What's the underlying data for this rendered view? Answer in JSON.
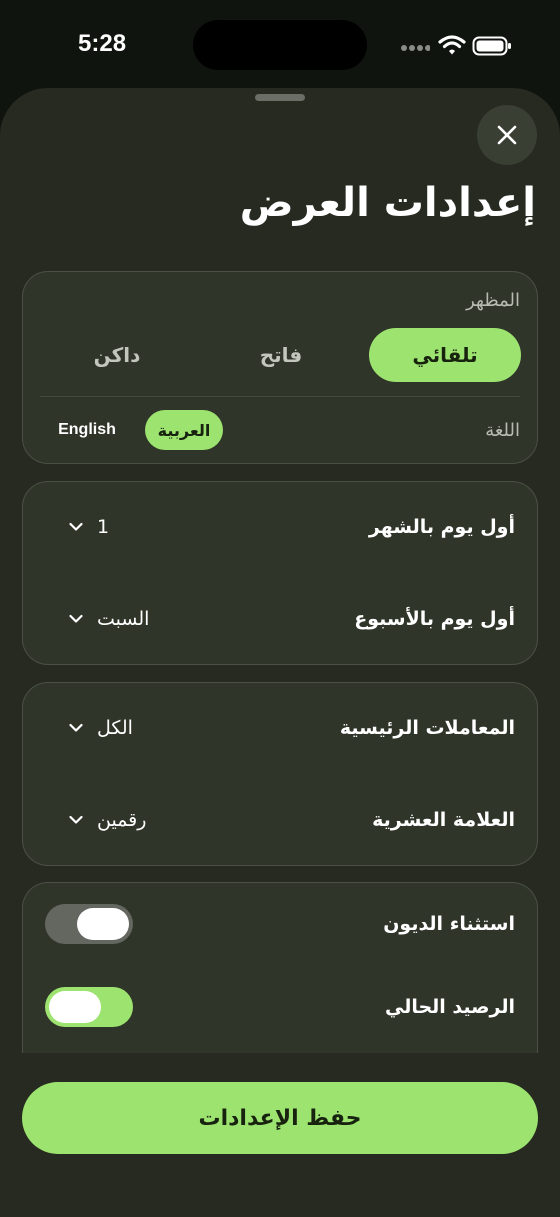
{
  "status_bar": {
    "time": "5:28"
  },
  "title": "إعدادات العرض",
  "appearance": {
    "label": "المظهر",
    "options": [
      "تلقائي",
      "فاتح",
      "داكن"
    ],
    "selected": "تلقائي"
  },
  "language": {
    "label": "اللغة",
    "options": [
      "العربية",
      "English"
    ],
    "selected": "العربية"
  },
  "dates": {
    "first_day_month": {
      "label": "أول يوم بالشهر",
      "value": "1"
    },
    "first_day_week": {
      "label": "أول يوم بالأسبوع",
      "value": "السبت"
    }
  },
  "formatting": {
    "main_transactions": {
      "label": "المعاملات الرئيسية",
      "value": "الكل"
    },
    "decimal_mark": {
      "label": "العلامة العشرية",
      "value": "رقمين"
    }
  },
  "toggles": {
    "exclude_debts": {
      "label": "استثناء الديون",
      "on": false
    },
    "current_balance": {
      "label": "الرصيد الحالي",
      "on": true
    }
  },
  "save_button": "حفظ الإعدادات",
  "colors": {
    "accent": "#9de36f",
    "sheet": "#262a20",
    "card": "#30352a",
    "toggle_off": "#63675f"
  },
  "icons": {
    "close": "close-icon",
    "chevron": "chevron-down-icon",
    "signal": "signal-dots-icon",
    "wifi": "wifi-icon",
    "battery": "battery-icon"
  }
}
